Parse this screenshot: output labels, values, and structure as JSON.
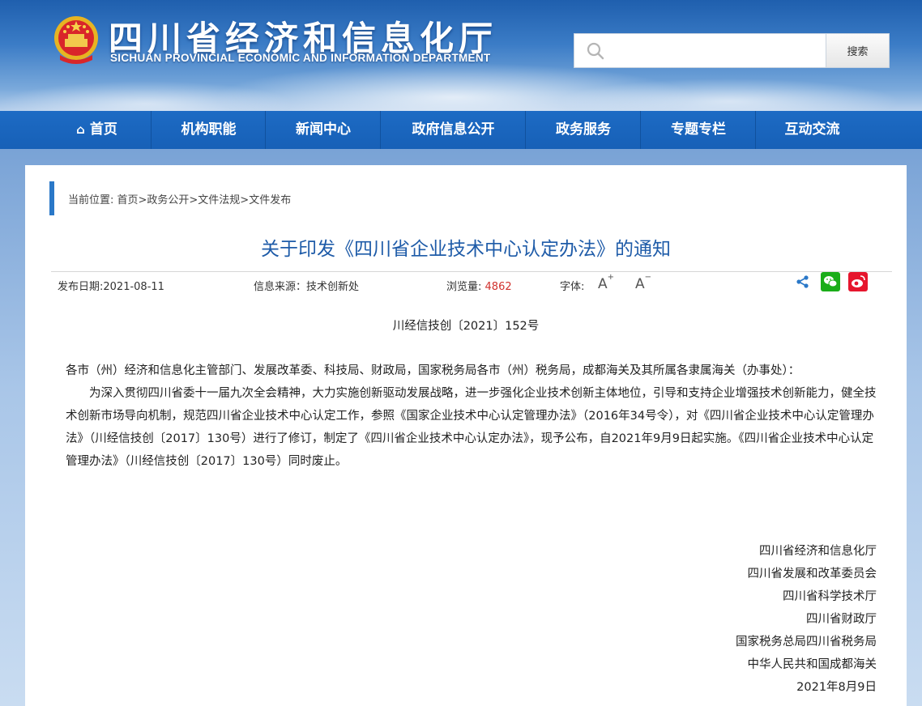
{
  "header": {
    "title": "四川省经济和信息化厅",
    "subtitle": "SICHUAN PROVINCIAL ECONOMIC AND INFORMATION DEPARTMENT",
    "emblem_icon": "national-emblem-icon"
  },
  "search": {
    "placeholder": "",
    "value": "",
    "button_label": "搜索"
  },
  "nav": {
    "items": [
      {
        "label": "首页",
        "icon": "home-icon"
      },
      {
        "label": "机构职能"
      },
      {
        "label": "新闻中心"
      },
      {
        "label": "政府信息公开"
      },
      {
        "label": "政务服务"
      },
      {
        "label": "专题专栏"
      },
      {
        "label": "互动交流"
      }
    ]
  },
  "breadcrumb": {
    "text": "当前位置: 首页>政务公开>文件法规>文件发布"
  },
  "article": {
    "title": "关于印发《四川省企业技术中心认定办法》的通知",
    "meta": {
      "date_label": "发布日期:2021-08-11",
      "source_label": "信息来源：技术创新处",
      "views_label": "浏览量:",
      "views_value": "4862",
      "font_label": "字体:",
      "font_increase": "A",
      "font_decrease": "A"
    },
    "doc_number": "川经信技创〔2021〕152号",
    "salutation": "各市（州）经济和信息化主管部门、发展改革委、科技局、财政局，国家税务局各市（州）税务局，成都海关及其所属各隶属海关（办事处）：",
    "paragraph": "为深入贯彻四川省委十一届九次全会精神，大力实施创新驱动发展战略，进一步强化企业技术创新主体地位，引导和支持企业增强技术创新能力，健全技术创新市场导向机制，规范四川省企业技术中心认定工作，参照《国家企业技术中心认定管理办法》（2016年34号令），对《四川省企业技术中心认定管理办法》（川经信技创〔2017〕130号）进行了修订，制定了《四川省企业技术中心认定办法》，现予公布，自2021年9月9日起实施。《四川省企业技术中心认定管理办法》（川经信技创〔2017〕130号）同时废止。",
    "signatories": [
      "四川省经济和信息化厅",
      "四川省发展和改革委员会",
      "四川省科学技术厅",
      "四川省财政厅",
      "国家税务总局四川省税务局",
      "中华人民共和国成都海关",
      "2021年8月9日"
    ]
  },
  "colors": {
    "nav_bg": "#1760b7",
    "title_blue": "#1e5ba8",
    "accent_red": "#d0312d"
  }
}
